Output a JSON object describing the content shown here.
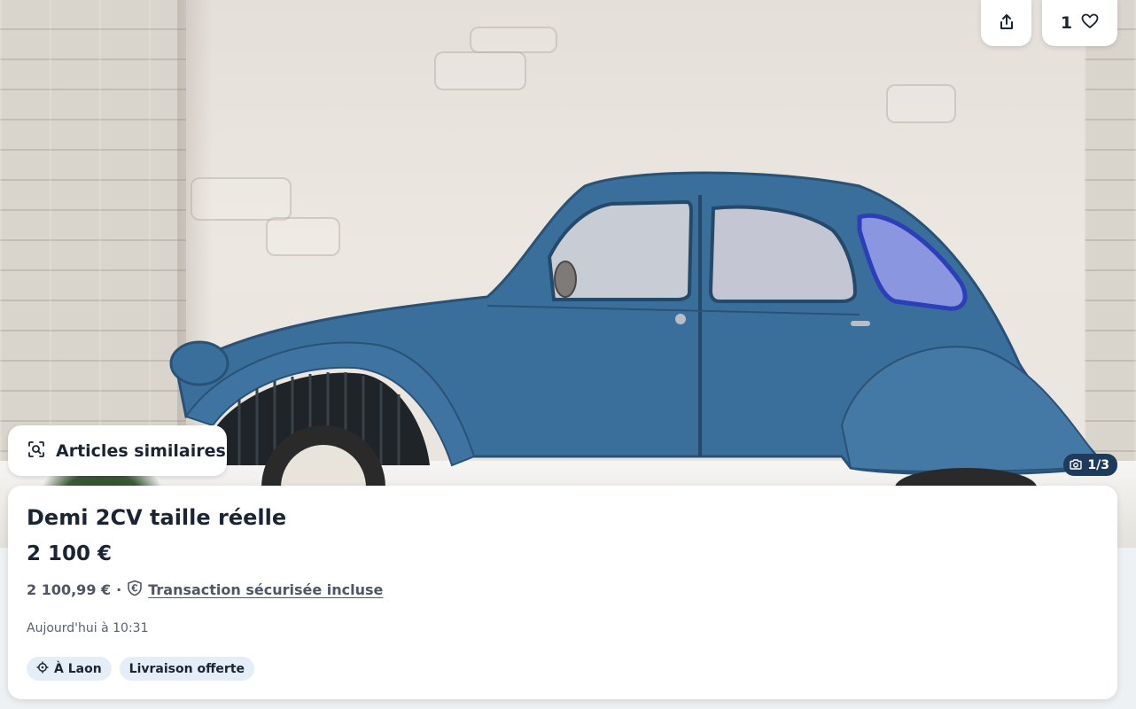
{
  "actions": {
    "share_icon": "share-icon",
    "favorite_count": "1",
    "favorite_icon": "heart-icon"
  },
  "photo": {
    "counter": "1/3",
    "camera_icon": "camera-icon"
  },
  "similar": {
    "label": "Articles similaires",
    "icon": "visual-search-icon"
  },
  "listing": {
    "title": "Demi 2CV taille réelle",
    "price": "2 100 €",
    "total_price": "2 100,99 €",
    "separator": "·",
    "secure_icon": "euro-shield-icon",
    "secure_label": "Transaction sécurisée incluse",
    "date": "Aujourd'hui à 10:31",
    "tags": [
      {
        "icon": "location-icon",
        "label": "À Laon"
      },
      {
        "label": "Livraison offerte"
      }
    ]
  },
  "colors": {
    "text_primary": "#1a2433",
    "text_secondary": "#4e5663",
    "tag_background": "#e5eef8",
    "counter_background": "#1f3b5c",
    "car_blue": "#3a6f9c"
  }
}
